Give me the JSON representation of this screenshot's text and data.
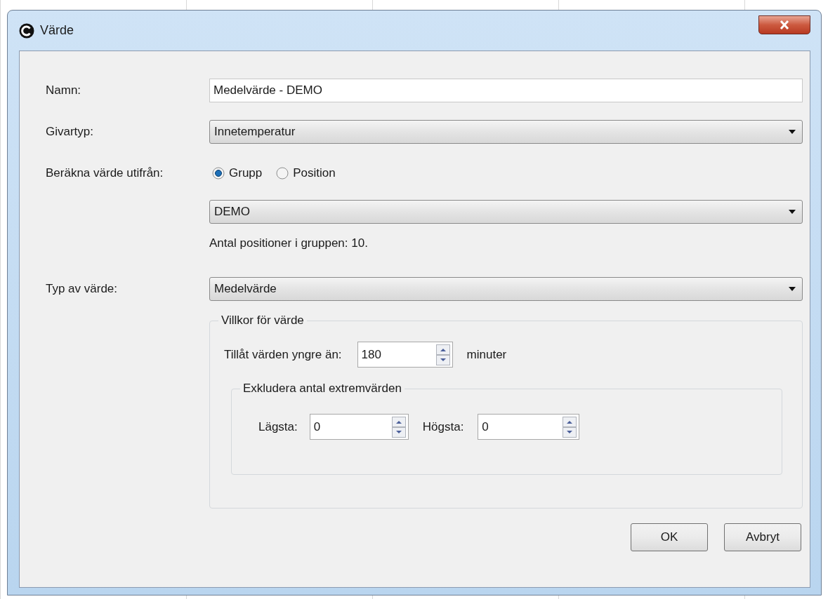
{
  "window": {
    "title": "Värde"
  },
  "fields": {
    "name": {
      "label": "Namn:",
      "value": "Medelvärde - DEMO"
    },
    "sensor_type": {
      "label": "Givartyp:",
      "value": "Innetemperatur"
    },
    "basis": {
      "label": "Beräkna värde utifrån:",
      "options": [
        {
          "label": "Grupp",
          "selected": true
        },
        {
          "label": "Position",
          "selected": false
        }
      ]
    },
    "group": {
      "value": "DEMO"
    },
    "group_info": "Antal positioner i gruppen: 10.",
    "value_type": {
      "label": "Typ av värde:",
      "value": "Medelvärde"
    }
  },
  "conditions": {
    "title": "Villkor för värde",
    "age": {
      "label": "Tillåt värden yngre än:",
      "value": "180",
      "unit": "minuter"
    },
    "extremes": {
      "title": "Exkludera antal extremvärden",
      "lowest": {
        "label": "Lägsta:",
        "value": "0"
      },
      "highest": {
        "label": "Högsta:",
        "value": "0"
      }
    }
  },
  "buttons": [
    "OK",
    "Avbryt"
  ]
}
